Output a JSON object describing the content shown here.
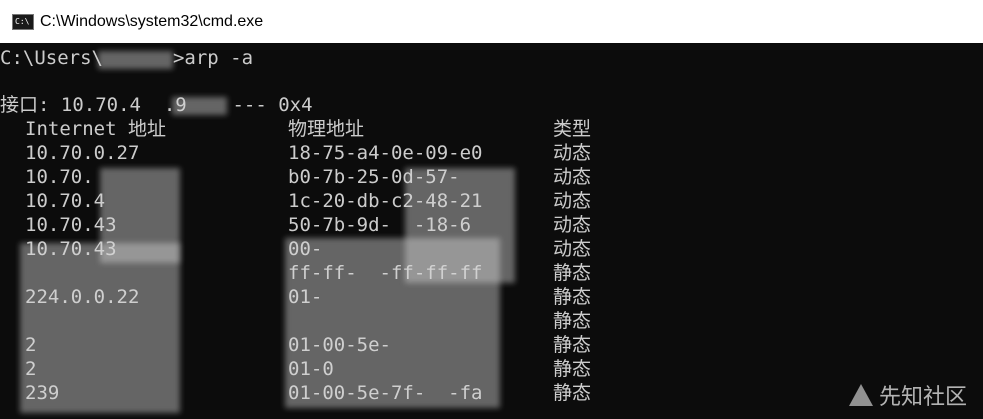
{
  "window": {
    "title": "C:\\Windows\\system32\\cmd.exe",
    "icon": "cmd-icon"
  },
  "console": {
    "prompt": "C:\\Users\\",
    "command": ">arp -a",
    "interface_line": "接口: 10.70.4  .9    --- 0x4",
    "headers": {
      "ip": "Internet 地址",
      "mac": "物理地址",
      "type": "类型"
    },
    "rows": [
      {
        "ip": "10.70.0.27",
        "mac": "18-75-a4-0e-09-e0",
        "type": "动态"
      },
      {
        "ip": "10.70.",
        "mac": "b0-7b-25-0d-57-",
        "type": "动态"
      },
      {
        "ip": "10.70.4",
        "mac": "1c-20-db-c2-48-21",
        "type": "动态"
      },
      {
        "ip": "10.70.43",
        "mac": "50-7b-9d-  -18-6",
        "type": "动态"
      },
      {
        "ip": "10.70.43",
        "mac": "00-",
        "type": "动态"
      },
      {
        "ip": "",
        "mac": "ff-ff-  -ff-ff-ff",
        "type": "静态"
      },
      {
        "ip": "224.0.0.22",
        "mac": "01-",
        "type": "静态"
      },
      {
        "ip": "",
        "mac": "",
        "type": "静态"
      },
      {
        "ip": "2",
        "mac": "01-00-5e-",
        "type": "静态"
      },
      {
        "ip": "2",
        "mac": "01-0",
        "type": "静态"
      },
      {
        "ip": "239",
        "mac": "01-00-5e-7f-  -fa",
        "type": "静态"
      }
    ]
  },
  "watermark": {
    "text": "先知社区"
  }
}
